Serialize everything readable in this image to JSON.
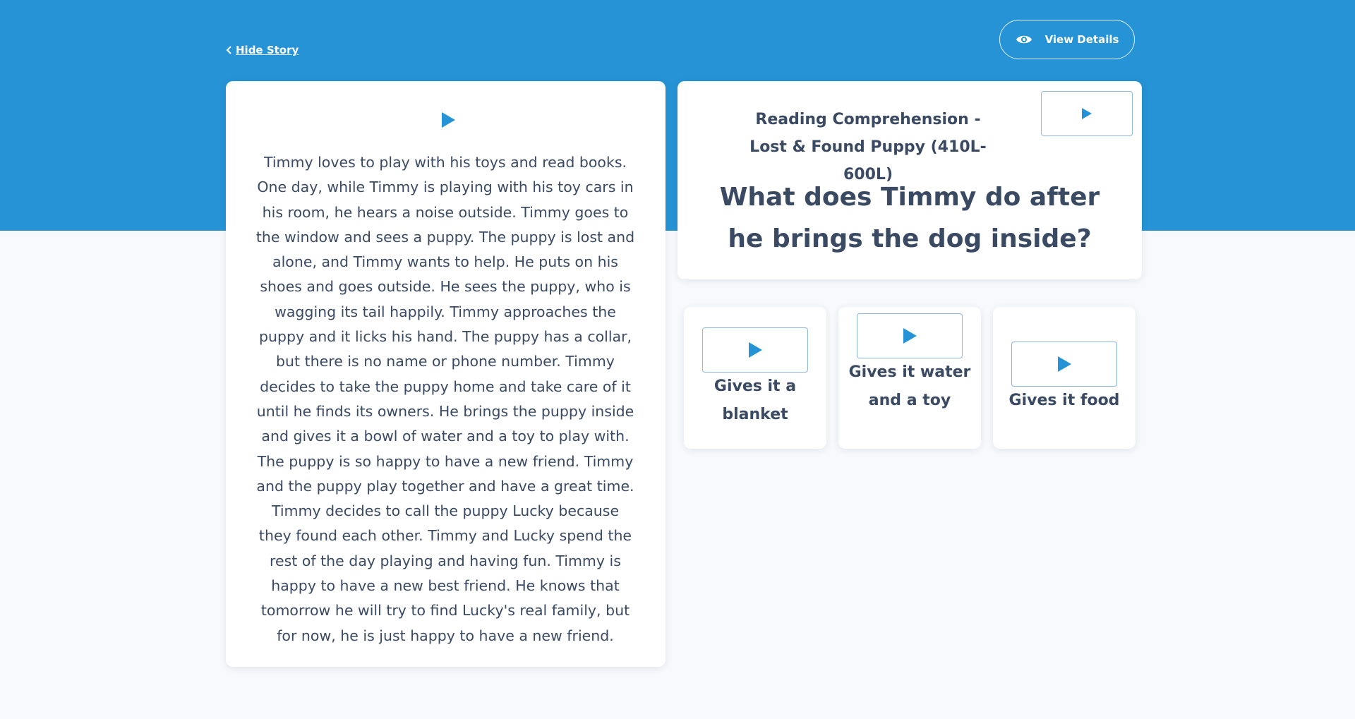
{
  "header": {
    "hide_story_label": "Hide Story",
    "view_details_label": "View Details"
  },
  "story": {
    "text": "Timmy loves to play with his toys and read books. One day, while Timmy is playing with his toy cars in his room, he hears a noise outside. Timmy goes to the window and sees a puppy. The puppy is lost and alone, and Timmy wants to help. He puts on his shoes and goes outside. He sees the puppy, who is wagging its tail happily. Timmy approaches the puppy and it licks his hand. The puppy has a collar, but there is no name or phone number. Timmy decides to take the puppy home and take care of it until he finds its owners. He brings the puppy inside and gives it a bowl of water and a toy to play with. The puppy is so happy to have a new friend. Timmy and the puppy play together and have a great time. Timmy decides to call the puppy Lucky because they found each other. Timmy and Lucky spend the rest of the day playing and having fun. Timmy is happy to have a new best friend. He knows that tomorrow he will try to find Lucky's real family, but for now, he is just happy to have a new friend."
  },
  "question": {
    "subtitle": "Reading Comprehension - Lost & Found Puppy (410L-600L)",
    "text": "What does Timmy do after he brings the dog inside?"
  },
  "answers": [
    {
      "label": "Gives it a blanket"
    },
    {
      "label": "Gives it water and a toy"
    },
    {
      "label": "Gives it food"
    }
  ],
  "colors": {
    "brand_blue": "#2593d5",
    "text_dark": "#3a4a63",
    "background": "#f7f9fc"
  },
  "icons": {
    "back": "chevron-left-icon",
    "view": "eye-icon",
    "audio": "play-icon"
  }
}
